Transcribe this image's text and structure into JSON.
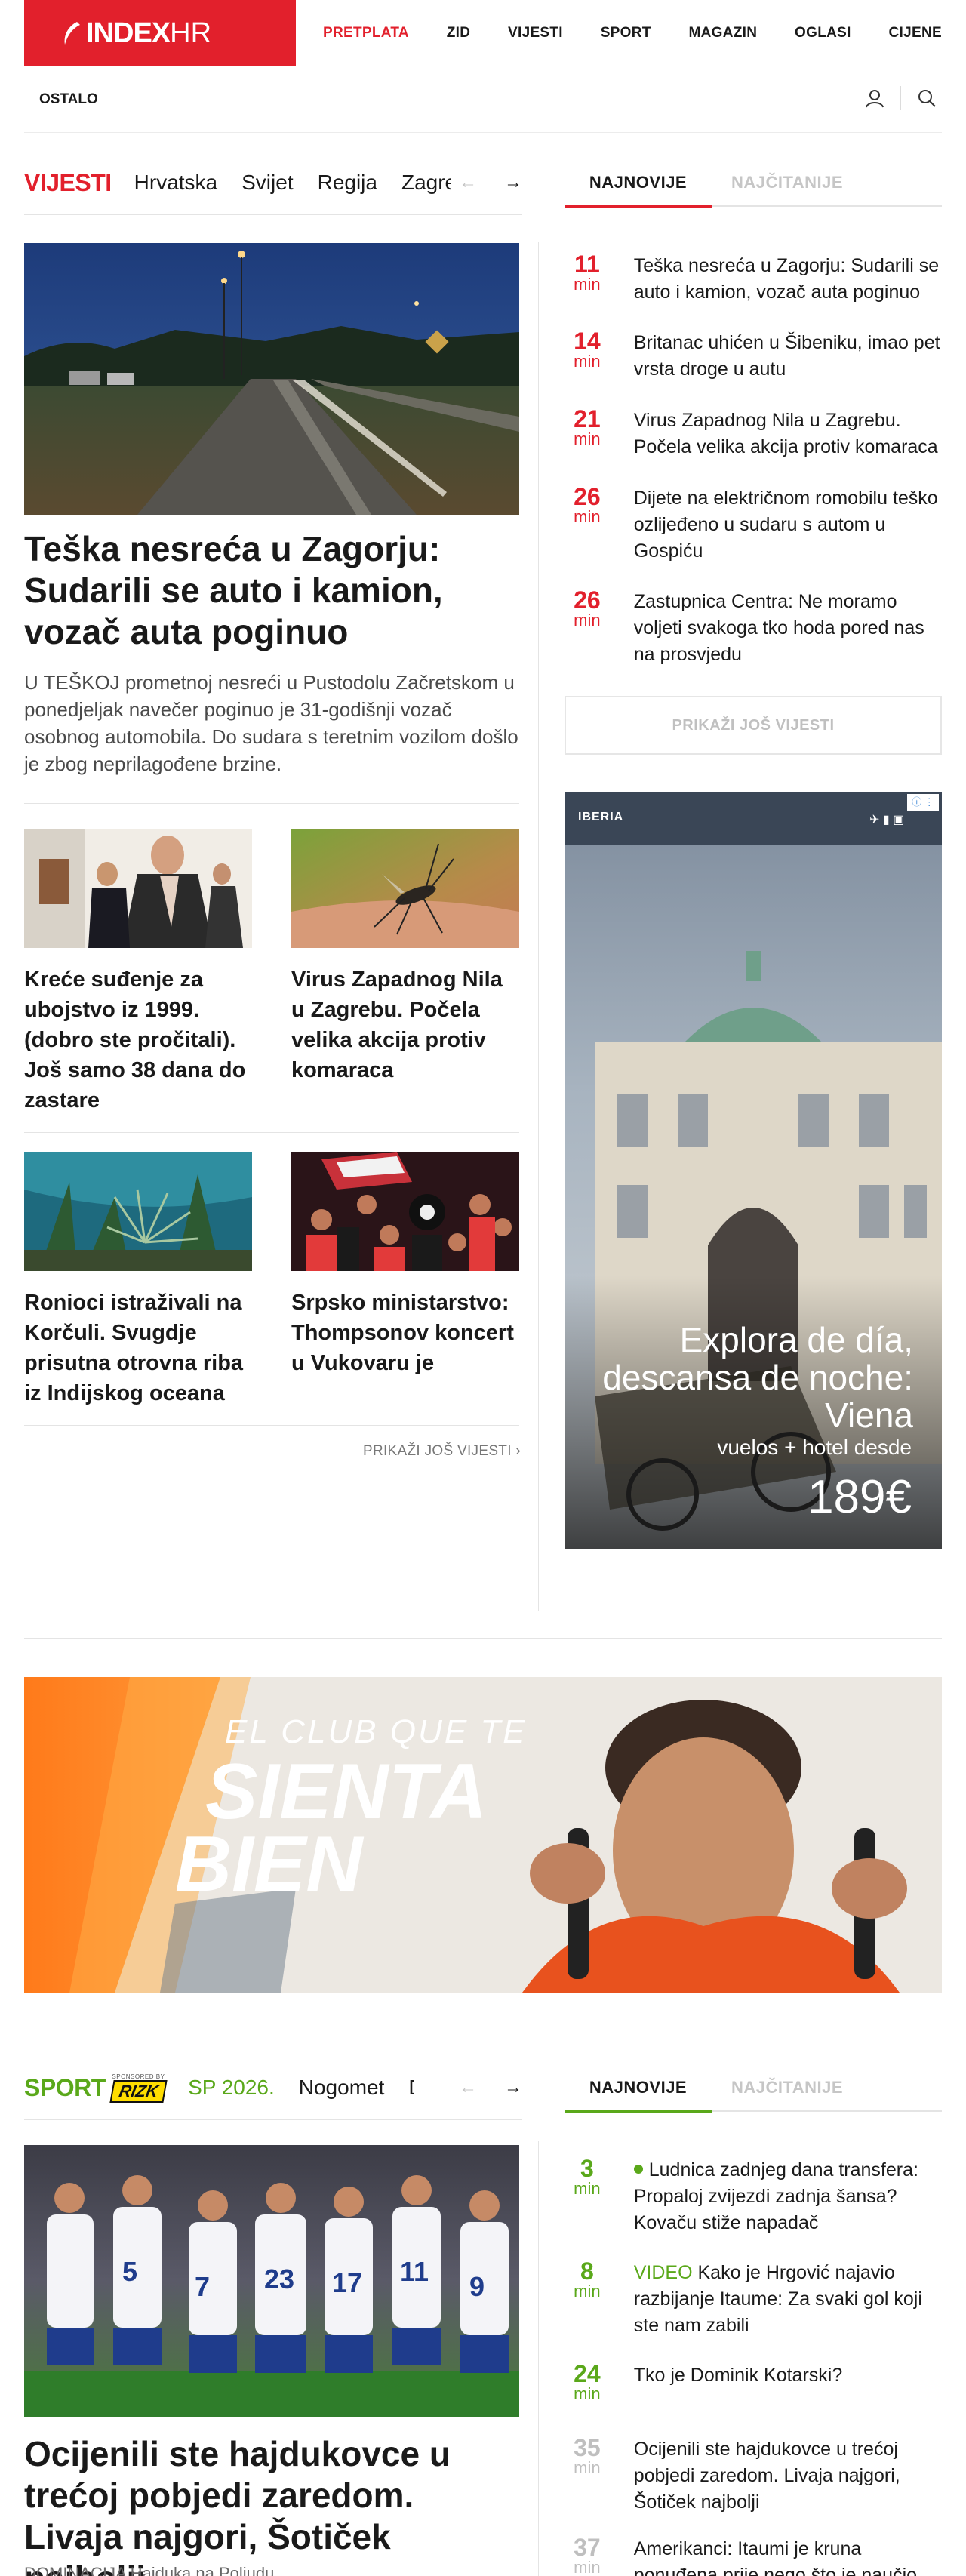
{
  "brand": {
    "logo_main": "INDEX",
    "logo_suffix": "HR",
    "accent": "#e2202c",
    "sport_accent": "#5aa81a"
  },
  "topnav": [
    "PRETPLATA",
    "ZID",
    "VIJESTI",
    "SPORT",
    "MAGAZIN",
    "OGLASI",
    "CIJENE"
  ],
  "subnav": {
    "ostalo": "OSTALO"
  },
  "vijesti": {
    "section_title": "VIJESTI",
    "tabs": [
      "Hrvatska",
      "Svijet",
      "Regija",
      "Zagreb"
    ],
    "side_tabs": [
      "NAJNOVIJE",
      "NAJČITANIJE"
    ],
    "main": {
      "title": "Teška nesreća u Zagorju: Sudarili se auto i kamion, vozač auta poginuo",
      "lead": "U TEŠKOJ prometnoj nesreći u Pustodolu Začretskom u ponedjeljak navečer poginuo je 31-godišnji vozač osobnog automobila. Do sudara s teretnim vozilom došlo je zbog neprilagođene brzine."
    },
    "cards": [
      {
        "title": "Kreće suđenje za ubojstvo iz 1999. (dobro ste pročitali). Još samo 38 dana do zastare"
      },
      {
        "title": "Virus Zapadnog Nila u Zagrebu. Počela velika akcija protiv komaraca"
      },
      {
        "title": "Ronioci istraživali na Korčuli. Svugdje prisutna otrovna riba iz Indijskog oceana"
      },
      {
        "title": "Srpsko ministarstvo: Thompsonov koncert u Vukovaru je povijesni kontinuitet…"
      }
    ],
    "more_link": "PRIKAŽI JOŠ VIJESTI ›",
    "latest": [
      {
        "num": "11",
        "unit": "min",
        "text": "Teška nesreća u Zagorju: Sudarili se auto i kamion, vozač auta poginuo"
      },
      {
        "num": "14",
        "unit": "min",
        "text": "Britanac uhićen u Šibeniku, imao pet vrsta droge u autu"
      },
      {
        "num": "21",
        "unit": "min",
        "text": "Virus Zapadnog Nila u Zagrebu. Počela velika akcija protiv komaraca"
      },
      {
        "num": "26",
        "unit": "min",
        "text": "Dijete na električnom romobilu teško ozlijeđeno u sudaru s autom u Gospiću"
      },
      {
        "num": "26",
        "unit": "min",
        "text": "Zastupnica Centra: Ne moramo voljeti svakoga tko hoda pored nas na prosvjedu"
      }
    ],
    "side_more": "PRIKAŽI JOŠ VIJESTI"
  },
  "ad_side": {
    "brand": "IBERIA",
    "line1": "Explora de día,",
    "line2": "descansa de noche:",
    "line3": "Viena",
    "sub": "vuelos + hotel  desde",
    "price": "189€"
  },
  "ad_wide": {
    "line1": "EL CLUB QUE TE",
    "line2": "SIENTA",
    "line3": "BIEN"
  },
  "sport": {
    "section_title": "SPORT",
    "sponsor_label": "SPONSORED BY",
    "sponsor": "RIZK",
    "tabs": [
      "SP 2026.",
      "Nogomet",
      "Di"
    ],
    "side_tabs": [
      "NAJNOVIJE",
      "NAJČITANIJE"
    ],
    "main": {
      "title": "Ocijenili ste hajdukovce u trećoj pobjedi zaredom. Livaja najgori, Šotiček najbolji",
      "lead": "DOMINACIJA Hajduka na Poljudu"
    },
    "latest": [
      {
        "num": "3",
        "unit": "min",
        "prefix": "",
        "text": "Ludnica zadnjeg dana transfera: Propaloj zvijezdi zadnja šansa? Kovaču stiže napadač"
      },
      {
        "num": "8",
        "unit": "min",
        "prefix": "VIDEO",
        "text": "Kako je Hrgović najavio razbijanje Itaume: Za svaki gol koji ste nam zabili"
      },
      {
        "num": "24",
        "unit": "min",
        "prefix": "",
        "text": "Tko je Dominik Kotarski?"
      },
      {
        "num": "35",
        "unit": "min",
        "prefix": "",
        "text": "Ocijenili ste hajdukovce u trećoj pobjedi zaredom. Livaja najgori, Šotiček najbolji"
      },
      {
        "num": "37",
        "unit": "min",
        "prefix": "",
        "text": "Amerikanci: Itaumi je kruna ponuđena prije nego što je naučio"
      }
    ]
  }
}
